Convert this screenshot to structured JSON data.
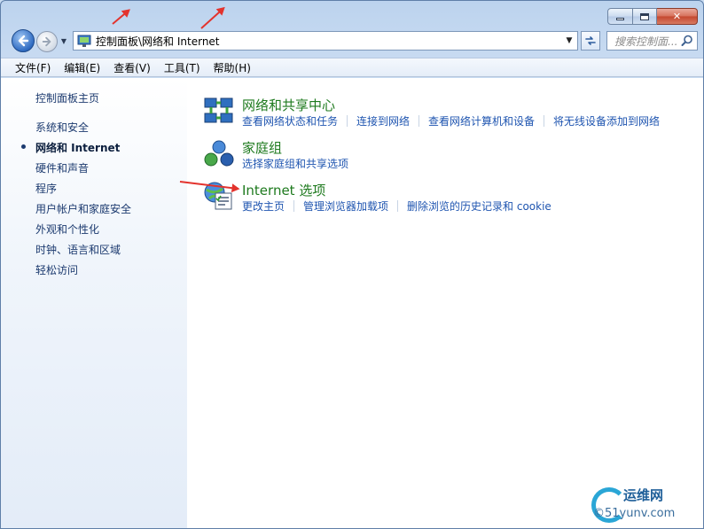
{
  "window": {
    "caption_buttons": {
      "minimize": "minimize-icon",
      "maximize": "maximize-icon",
      "close": "close-icon"
    }
  },
  "nav": {
    "back_icon": "back-arrow-icon",
    "forward_icon": "forward-arrow-icon",
    "history_icon": "chevron-down-icon"
  },
  "address": {
    "icon": "control-panel-icon",
    "path": "控制面板\\网络和 Internet",
    "refresh_icon": "refresh-icon"
  },
  "search": {
    "placeholder": "搜索控制面...",
    "icon": "search-icon"
  },
  "menubar": {
    "items": [
      "文件(F)",
      "编辑(E)",
      "查看(V)",
      "工具(T)",
      "帮助(H)"
    ]
  },
  "sidebar": {
    "home": "控制面板主页",
    "items": [
      {
        "label": "系统和安全",
        "active": false
      },
      {
        "label": "网络和 Internet",
        "active": true
      },
      {
        "label": "硬件和声音",
        "active": false
      },
      {
        "label": "程序",
        "active": false
      },
      {
        "label": "用户帐户和家庭安全",
        "active": false
      },
      {
        "label": "外观和个性化",
        "active": false
      },
      {
        "label": "时钟、语言和区域",
        "active": false
      },
      {
        "label": "轻松访问",
        "active": false
      }
    ]
  },
  "categories": [
    {
      "icon": "network-sharing-center-icon",
      "title": "网络和共享中心",
      "links": [
        "查看网络状态和任务",
        "连接到网络",
        "查看网络计算机和设备",
        "将无线设备添加到网络"
      ]
    },
    {
      "icon": "homegroup-icon",
      "title": "家庭组",
      "links": [
        "选择家庭组和共享选项"
      ]
    },
    {
      "icon": "internet-options-icon",
      "title": "Internet 选项",
      "links": [
        "更改主页",
        "管理浏览器加载项",
        "删除浏览的历史记录和 cookie"
      ]
    }
  ],
  "watermark": {
    "cn": "运维网",
    "en": "©51yunv.com"
  },
  "colors": {
    "link": "#1f55b0",
    "category_title": "#1e7a1e",
    "annotation_arrow": "#e3332d"
  }
}
